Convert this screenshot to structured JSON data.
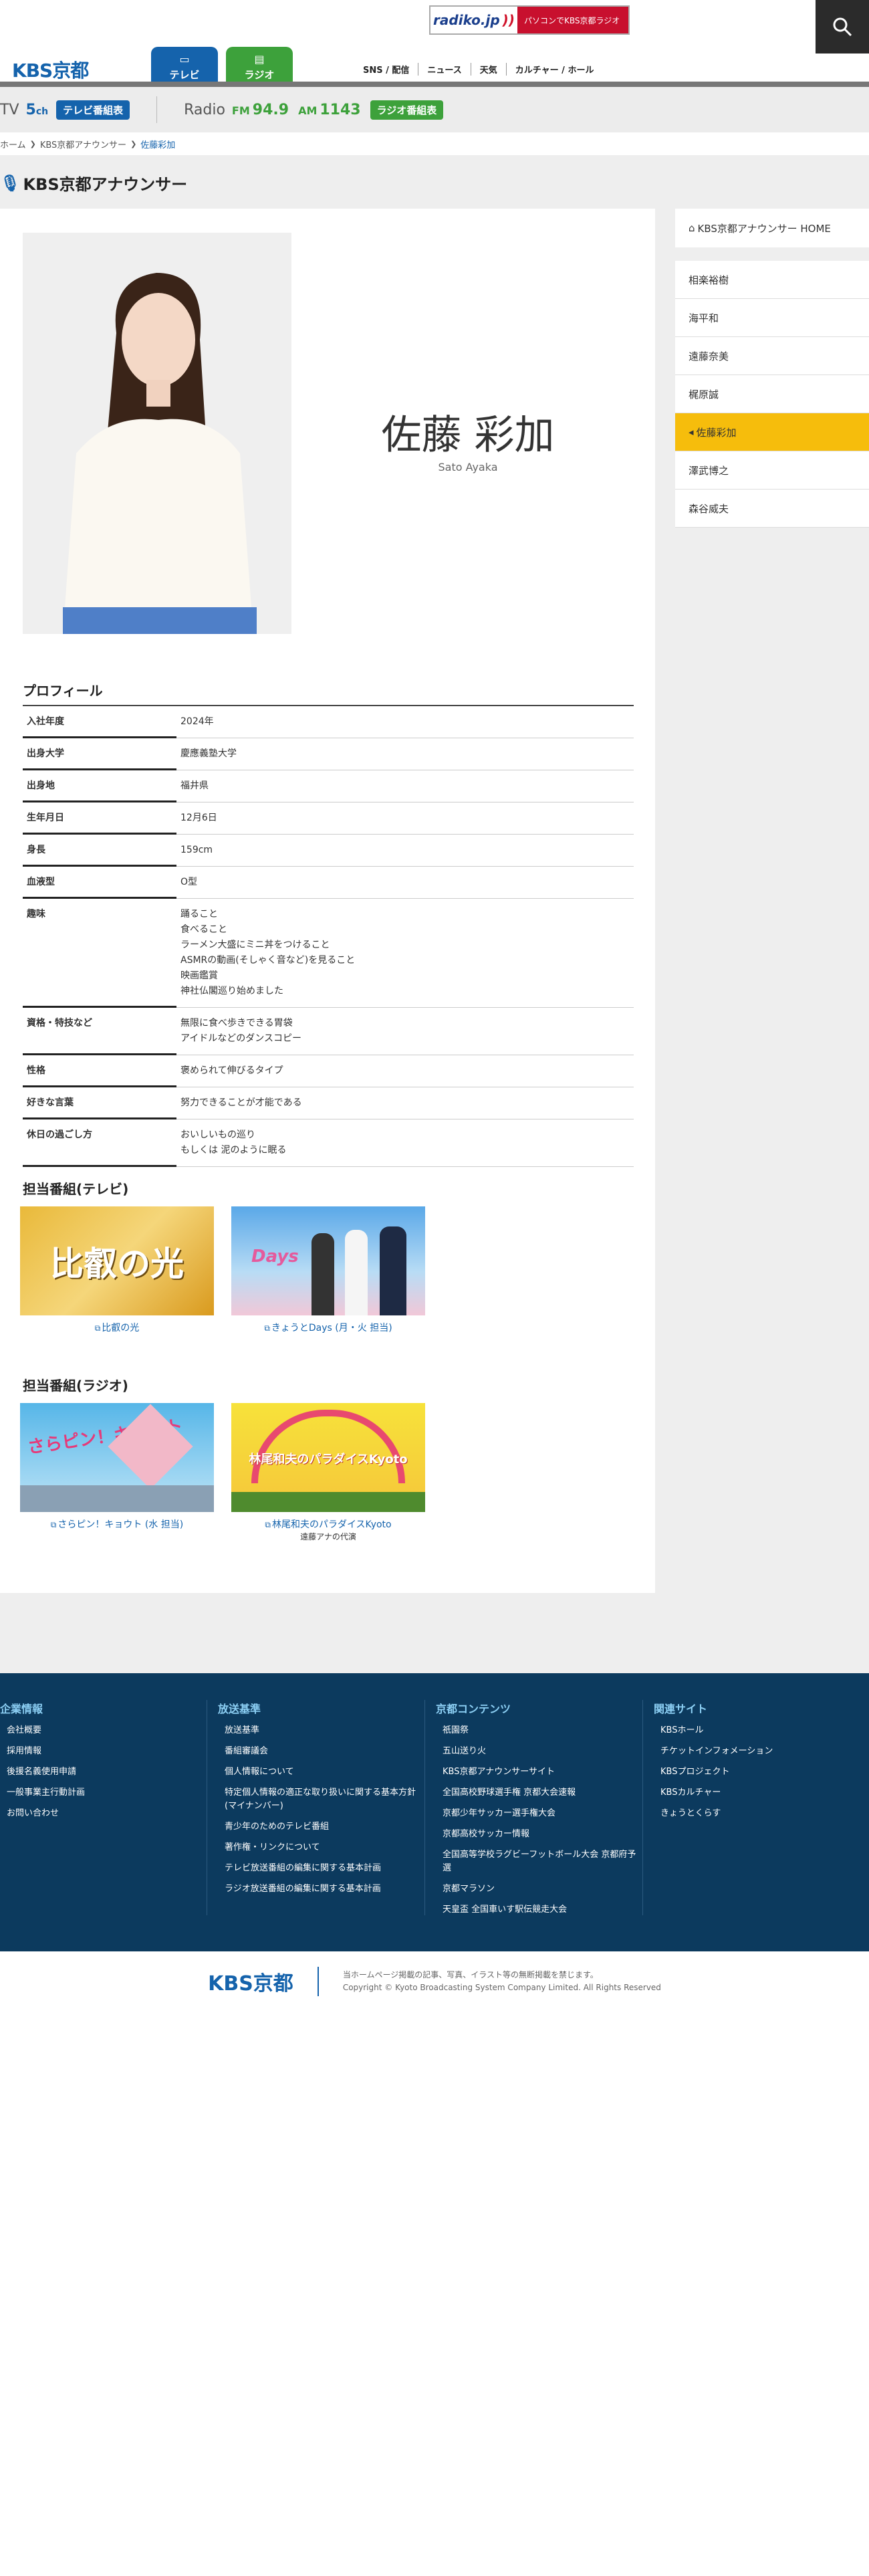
{
  "header": {
    "radiko_logo": "radiko.jp",
    "radiko_text": "パソコンでKBS京都ラジオ",
    "logo": "KBS京都",
    "tabs": [
      {
        "label": "テレビ",
        "icon": "tv-icon"
      },
      {
        "label": "ラジオ",
        "icon": "radio-icon"
      }
    ],
    "links": [
      "SNS / 配信",
      "ニュース",
      "天気",
      "カルチャー / ホール"
    ]
  },
  "program_bar": {
    "tv_label": "TV",
    "tv_channel": "5",
    "tv_channel_unit": "ch",
    "tv_button": "テレビ番組表",
    "radio_label": "Radio",
    "fm_prefix": "FM",
    "fm_freq": "94.9",
    "am_prefix": "AM",
    "am_freq": "1143",
    "radio_button": "ラジオ番組表"
  },
  "breadcrumb": {
    "items": [
      "ホーム",
      "KBS京都アナウンサー",
      "佐藤彩加"
    ]
  },
  "section_title": "KBS京都アナウンサー",
  "announcer": {
    "name_jp": "佐藤 彩加",
    "name_en": "Sato Ayaka"
  },
  "profile": {
    "title": "プロフィール",
    "rows": [
      {
        "key": "入社年度",
        "value": "2024年"
      },
      {
        "key": "出身大学",
        "value": "慶應義塾大学"
      },
      {
        "key": "出身地",
        "value": "福井県"
      },
      {
        "key": "生年月日",
        "value": "12月6日"
      },
      {
        "key": "身長",
        "value": "159cm"
      },
      {
        "key": "血液型",
        "value": "O型"
      },
      {
        "key": "趣味",
        "value": "踊ること\n食べること\nラーメン大盛にミニ丼をつけること\nASMRの動画(そしゃく音など)を見ること\n映画鑑賞\n神社仏閣巡り始めました"
      },
      {
        "key": "資格・特技など",
        "value": "無限に食べ歩きできる胃袋\nアイドルなどのダンスコピー"
      },
      {
        "key": "性格",
        "value": "褒められて伸びるタイプ"
      },
      {
        "key": "好きな言葉",
        "value": "努力できることが才能である"
      },
      {
        "key": "休日の過ごし方",
        "value": "おいしいもの巡り\nもしくは 泥のように眠る"
      }
    ]
  },
  "programs_tv": {
    "title": "担当番組(テレビ)",
    "items": [
      {
        "label": "比叡の光",
        "image_text": "比叡の光"
      },
      {
        "label": "きょうとDays (月・火 担当)",
        "image_text": "Days"
      }
    ]
  },
  "programs_radio": {
    "title": "担当番組(ラジオ)",
    "items": [
      {
        "label": "さらピン！キョウト (水 担当)",
        "image_text": "さらピン！キョウト",
        "sub": ""
      },
      {
        "label": "林尾和夫のパラダイスKyoto",
        "image_text": "林尾和夫のパラダイスKyoto",
        "sub": "遠藤アナの代演"
      }
    ]
  },
  "sidebar": {
    "home": "KBS京都アナウンサー HOME",
    "items": [
      "相楽裕樹",
      "海平和",
      "遠藤奈美",
      "梶原誠",
      "佐藤彩加",
      "澤武博之",
      "森谷威夫"
    ],
    "active": "佐藤彩加"
  },
  "footer": {
    "columns": [
      {
        "title": "企業情報",
        "items": [
          "会社概要",
          "採用情報",
          "後援名義使用申請",
          "一般事業主行動計画",
          "お問い合わせ"
        ]
      },
      {
        "title": "放送基準",
        "items": [
          "放送基準",
          "番組審議会",
          "個人情報について",
          "特定個人情報の適正な取り扱いに関する基本方針(マイナンバー)",
          "青少年のためのテレビ番組",
          "著作権・リンクについて",
          "テレビ放送番組の編集に関する基本計画",
          "ラジオ放送番組の編集に関する基本計画"
        ]
      },
      {
        "title": "京都コンテンツ",
        "items": [
          "祇園祭",
          "五山送り火",
          "KBS京都アナウンサーサイト",
          "全国高校野球選手権 京都大会速報",
          "京都少年サッカー選手権大会",
          "京都高校サッカー情報",
          "全国高等学校ラグビーフットボール大会 京都府予選",
          "京都マラソン",
          "天皇盃 全国車いす駅伝競走大会"
        ]
      },
      {
        "title": "関連サイト",
        "items": [
          "KBSホール",
          "チケットインフォメーション",
          "KBSプロジェクト",
          "KBSカルチャー",
          "きょうとくらす"
        ]
      }
    ],
    "bottom_logo": "KBS京都",
    "notice": "当ホームページ掲載の記事、写真、イラスト等の無断掲載を禁じます。",
    "copyright": "Copyright © Kyoto Broadcasting System Company Limited. All Rights Reserved"
  }
}
